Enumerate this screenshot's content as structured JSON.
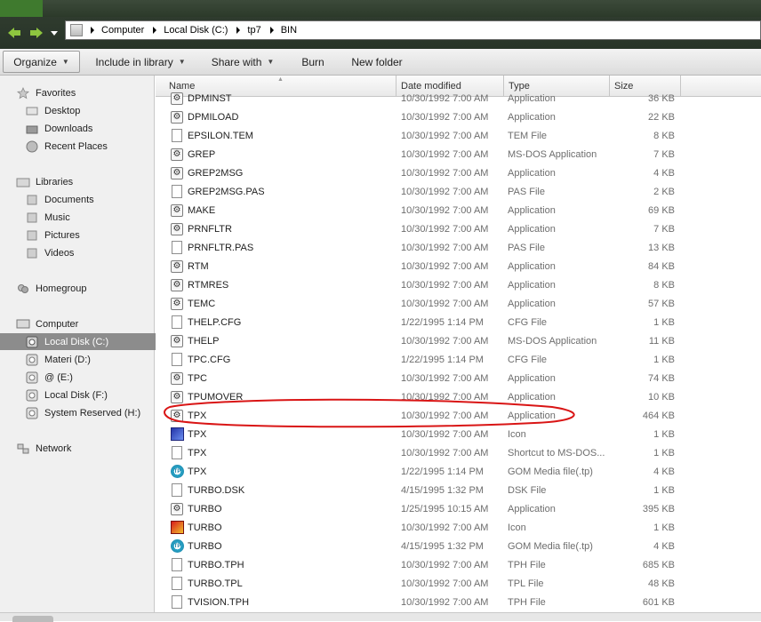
{
  "address": {
    "breadcrumb": [
      "Computer",
      "Local Disk (C:)",
      "tp7",
      "BIN"
    ]
  },
  "toolbar": {
    "organize": "Organize",
    "include_in_library": "Include in library",
    "share_with": "Share with",
    "burn": "Burn",
    "new_folder": "New folder"
  },
  "sidebar": {
    "favorites": {
      "label": "Favorites",
      "items": [
        "Desktop",
        "Downloads",
        "Recent Places"
      ]
    },
    "libraries": {
      "label": "Libraries",
      "items": [
        "Documents",
        "Music",
        "Pictures",
        "Videos"
      ]
    },
    "homegroup": "Homegroup",
    "computer": {
      "label": "Computer",
      "items": [
        "Local Disk (C:)",
        "Materi (D:)",
        "@ (E:)",
        "Local Disk (F:)",
        "System Reserved (H:)"
      ],
      "selected": "Local Disk (C:)"
    },
    "network": "Network"
  },
  "columns": {
    "name": "Name",
    "date": "Date modified",
    "type": "Type",
    "size": "Size"
  },
  "files": [
    {
      "name": "DPMINST",
      "date": "10/30/1992 7:00 AM",
      "type": "Application",
      "size": "36 KB",
      "icon": "app-icon"
    },
    {
      "name": "DPMILOAD",
      "date": "10/30/1992 7:00 AM",
      "type": "Application",
      "size": "22 KB",
      "icon": "app-icon"
    },
    {
      "name": "EPSILON.TEM",
      "date": "10/30/1992 7:00 AM",
      "type": "TEM File",
      "size": "8 KB",
      "icon": "file-icon"
    },
    {
      "name": "GREP",
      "date": "10/30/1992 7:00 AM",
      "type": "MS-DOS Application",
      "size": "7 KB",
      "icon": "app-icon"
    },
    {
      "name": "GREP2MSG",
      "date": "10/30/1992 7:00 AM",
      "type": "Application",
      "size": "4 KB",
      "icon": "app-icon"
    },
    {
      "name": "GREP2MSG.PAS",
      "date": "10/30/1992 7:00 AM",
      "type": "PAS File",
      "size": "2 KB",
      "icon": "file-icon"
    },
    {
      "name": "MAKE",
      "date": "10/30/1992 7:00 AM",
      "type": "Application",
      "size": "69 KB",
      "icon": "app-icon"
    },
    {
      "name": "PRNFLTR",
      "date": "10/30/1992 7:00 AM",
      "type": "Application",
      "size": "7 KB",
      "icon": "app-icon"
    },
    {
      "name": "PRNFLTR.PAS",
      "date": "10/30/1992 7:00 AM",
      "type": "PAS File",
      "size": "13 KB",
      "icon": "file-icon"
    },
    {
      "name": "RTM",
      "date": "10/30/1992 7:00 AM",
      "type": "Application",
      "size": "84 KB",
      "icon": "app-icon"
    },
    {
      "name": "RTMRES",
      "date": "10/30/1992 7:00 AM",
      "type": "Application",
      "size": "8 KB",
      "icon": "app-icon"
    },
    {
      "name": "TEMC",
      "date": "10/30/1992 7:00 AM",
      "type": "Application",
      "size": "57 KB",
      "icon": "app-icon"
    },
    {
      "name": "THELP.CFG",
      "date": "1/22/1995 1:14 PM",
      "type": "CFG File",
      "size": "1 KB",
      "icon": "file-icon"
    },
    {
      "name": "THELP",
      "date": "10/30/1992 7:00 AM",
      "type": "MS-DOS Application",
      "size": "11 KB",
      "icon": "app-icon"
    },
    {
      "name": "TPC.CFG",
      "date": "1/22/1995 1:14 PM",
      "type": "CFG File",
      "size": "1 KB",
      "icon": "file-icon"
    },
    {
      "name": "TPC",
      "date": "10/30/1992 7:00 AM",
      "type": "Application",
      "size": "74 KB",
      "icon": "app-icon"
    },
    {
      "name": "TPUMOVER",
      "date": "10/30/1992 7:00 AM",
      "type": "Application",
      "size": "10 KB",
      "icon": "app-icon"
    },
    {
      "name": "TPX",
      "date": "10/30/1992 7:00 AM",
      "type": "Application",
      "size": "464 KB",
      "icon": "app-icon"
    },
    {
      "name": "TPX",
      "date": "10/30/1992 7:00 AM",
      "type": "Icon",
      "size": "1 KB",
      "icon": "tp-icon"
    },
    {
      "name": "TPX",
      "date": "10/30/1992 7:00 AM",
      "type": "Shortcut to MS-DOS...",
      "size": "1 KB",
      "icon": "file-icon"
    },
    {
      "name": "TPX",
      "date": "1/22/1995 1:14 PM",
      "type": "GOM Media file(.tp)",
      "size": "4 KB",
      "icon": "gom-icon"
    },
    {
      "name": "TURBO.DSK",
      "date": "4/15/1995 1:32 PM",
      "type": "DSK File",
      "size": "1 KB",
      "icon": "file-icon"
    },
    {
      "name": "TURBO",
      "date": "1/25/1995 10:15 AM",
      "type": "Application",
      "size": "395 KB",
      "icon": "app-icon"
    },
    {
      "name": "TURBO",
      "date": "10/30/1992 7:00 AM",
      "type": "Icon",
      "size": "1 KB",
      "icon": "turbo-icon"
    },
    {
      "name": "TURBO",
      "date": "4/15/1995 1:32 PM",
      "type": "GOM Media file(.tp)",
      "size": "4 KB",
      "icon": "gom-icon"
    },
    {
      "name": "TURBO.TPH",
      "date": "10/30/1992 7:00 AM",
      "type": "TPH File",
      "size": "685 KB",
      "icon": "file-icon"
    },
    {
      "name": "TURBO.TPL",
      "date": "10/30/1992 7:00 AM",
      "type": "TPL File",
      "size": "48 KB",
      "icon": "file-icon"
    },
    {
      "name": "TVISION.TPH",
      "date": "10/30/1992 7:00 AM",
      "type": "TPH File",
      "size": "601 KB",
      "icon": "file-icon"
    }
  ],
  "colors": {
    "annotation": "#d91515",
    "selected": "#8c8c8c",
    "theme": "#2f3b2e"
  }
}
